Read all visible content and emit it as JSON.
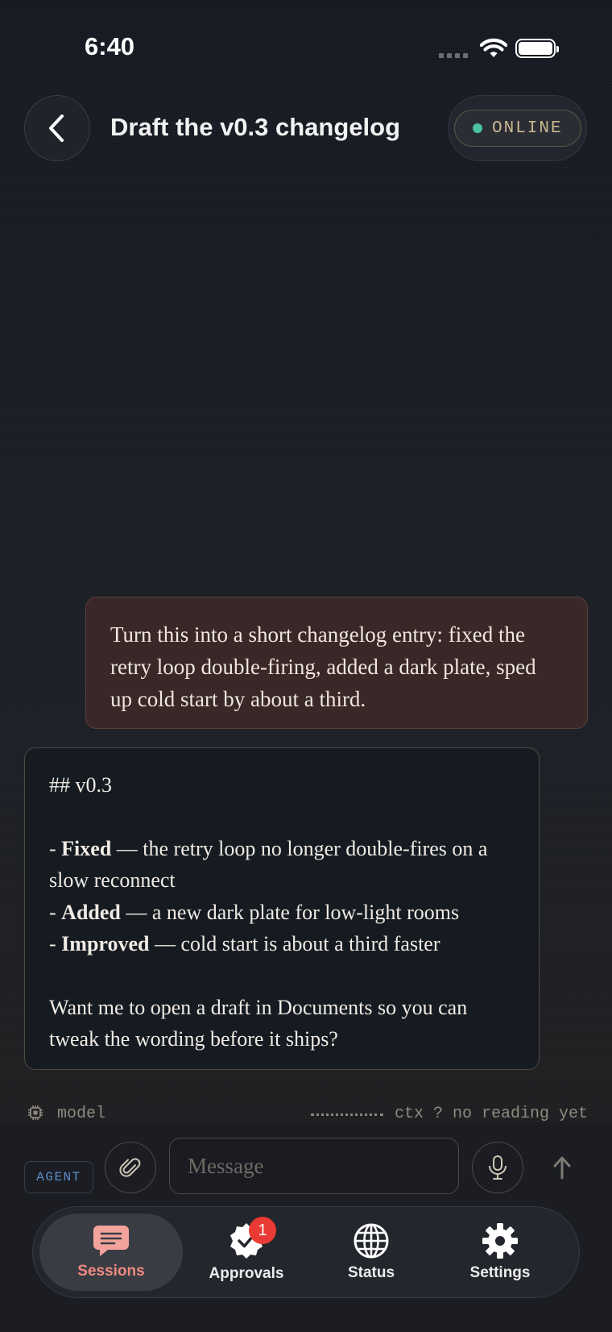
{
  "status_bar": {
    "time": "6:40"
  },
  "header": {
    "title": "Draft the v0.3 changelog",
    "status": "ONLINE"
  },
  "messages": {
    "user": "Turn this into a short changelog entry: fixed the retry loop double-firing, added a dark plate, sped up cold start by about a third.",
    "agent": {
      "heading": "## v0.3",
      "items": [
        {
          "prefix": "- ",
          "label": "Fixed",
          "text": " — the retry loop no longer double-fires on a slow reconnect"
        },
        {
          "prefix": "- ",
          "label": "Added",
          "text": " — a new dark plate for low-light rooms"
        },
        {
          "prefix": "- ",
          "label": "Improved",
          "text": " — cold start is about a third faster"
        }
      ],
      "closing": "Want me to open a draft in Documents so you can tweak the wording before it ships?"
    }
  },
  "meta": {
    "model_label": "model",
    "ctx_label": "ctx ? no reading yet"
  },
  "composer": {
    "agent_label": "AGENT",
    "placeholder": "Message"
  },
  "tabs": [
    {
      "label": "Sessions",
      "icon": "chat-bubble-icon",
      "active": true
    },
    {
      "label": "Approvals",
      "icon": "checkmark-badge-icon",
      "badge": "1"
    },
    {
      "label": "Status",
      "icon": "globe-icon"
    },
    {
      "label": "Settings",
      "icon": "gear-icon"
    }
  ],
  "colors": {
    "accent": "#f08a80",
    "online": "#4cc3a0",
    "badge": "#ea3a35",
    "agent_label": "#5b8cc6"
  }
}
